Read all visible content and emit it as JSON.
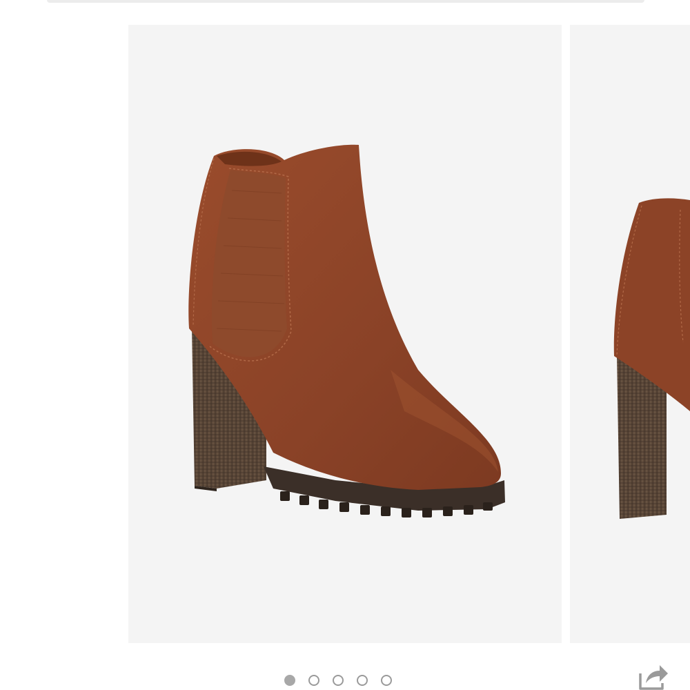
{
  "gallery": {
    "slides": [
      {
        "icon": "product-image-main"
      },
      {
        "icon": "product-image-next"
      }
    ],
    "dots": [
      {
        "active": true
      },
      {
        "active": false
      },
      {
        "active": false
      },
      {
        "active": false
      },
      {
        "active": false
      }
    ]
  },
  "toolbar": {
    "share_icon": "share-icon"
  },
  "colors": {
    "slide_background": "#f4f4f4",
    "suede": "#8e4528",
    "heel": "#5a4638",
    "sole": "#3b2f28",
    "dot_active": "#a8a8a8",
    "dot_inactive": "#9a9a9a"
  }
}
